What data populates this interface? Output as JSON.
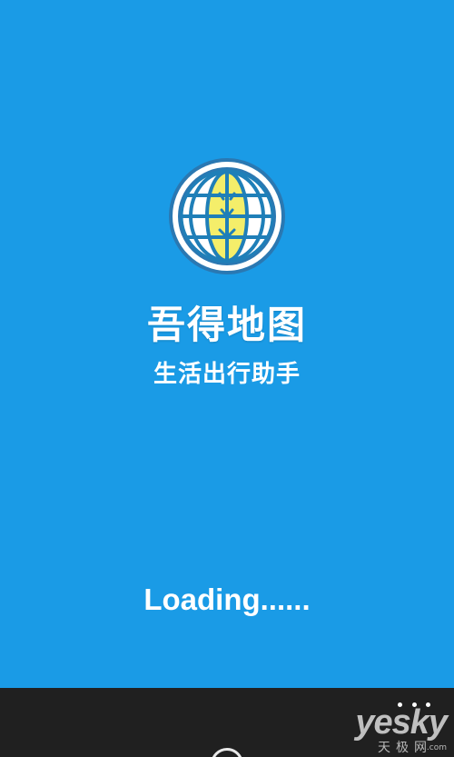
{
  "app": {
    "name": "吾得地图",
    "slogan": "生活出行助手",
    "loading_text": "Loading......"
  },
  "logo": {
    "icon": "globe-icon",
    "ring_color": "#ffffff",
    "globe_fill": "#f4ee6a",
    "grid_color": "#1f7fb8"
  },
  "app_bar": {
    "more_icon": "ellipsis-icon"
  },
  "watermark": {
    "brand": "yesky",
    "brand_cn": "天极网",
    "suffix": ".com"
  },
  "colors": {
    "background": "#1a9be6",
    "app_bar": "#202020",
    "text": "#ffffff"
  }
}
